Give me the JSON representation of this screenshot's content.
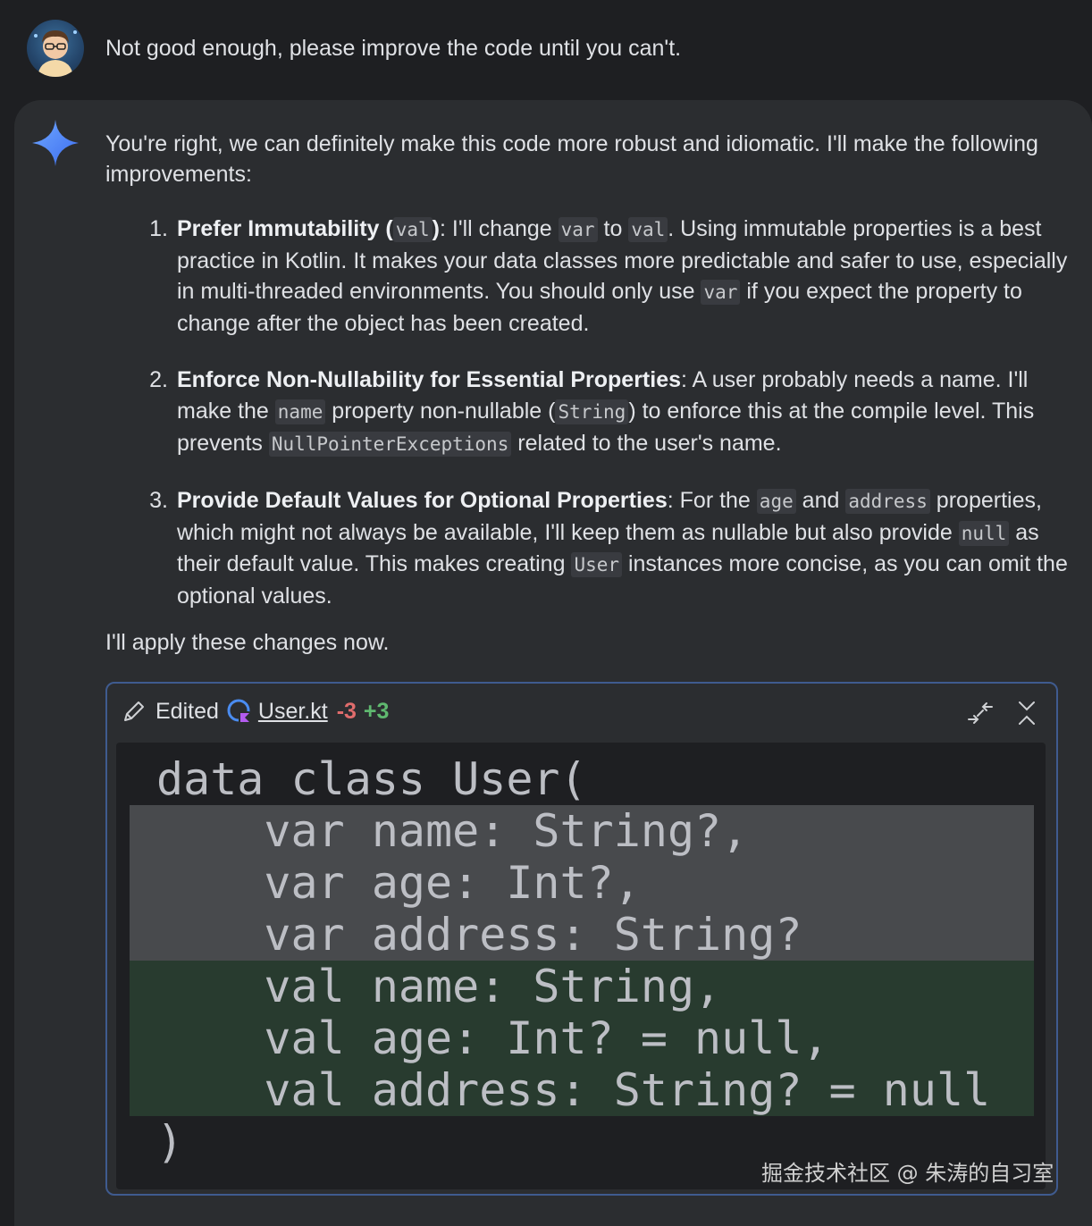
{
  "user_message": {
    "text": "Not good enough, please improve the code until you can't.",
    "avatar_icon": "user-avatar-icon"
  },
  "assistant": {
    "icon": "sparkle-icon",
    "intro": "You're right, we can definitely make this code more robust and idiomatic. I'll make the following improvements:",
    "items": [
      {
        "number": "1.",
        "title": "Prefer Immutability (",
        "title_code": "val",
        "title_end": ")",
        "parts": [
          {
            "t": ": I'll change "
          },
          {
            "c": "var"
          },
          {
            "t": " to "
          },
          {
            "c": "val"
          },
          {
            "t": ". Using immutable properties is a best practice in Kotlin. It makes your data classes more predictable and safer to use, especially in multi-threaded environments. You should only use "
          },
          {
            "c": "var"
          },
          {
            "t": " if you expect the property to change after the object has been created."
          }
        ]
      },
      {
        "number": "2.",
        "title": "Enforce Non-Nullability for Essential Properties",
        "title_code": "",
        "title_end": "",
        "parts": [
          {
            "t": ": A user probably needs a name. I'll make the "
          },
          {
            "c": "name"
          },
          {
            "t": " property non-nullable ("
          },
          {
            "c": "String"
          },
          {
            "t": ") to enforce this at the compile level. This prevents "
          },
          {
            "c": "NullPointerExceptions"
          },
          {
            "t": " related to the user's name."
          }
        ]
      },
      {
        "number": "3.",
        "title": "Provide Default Values for Optional Properties",
        "title_code": "",
        "title_end": "",
        "parts": [
          {
            "t": ": For the "
          },
          {
            "c": "age"
          },
          {
            "t": " and "
          },
          {
            "c": "address"
          },
          {
            "t": " properties, which might not always be available, I'll keep them as nullable but also provide "
          },
          {
            "c": "null"
          },
          {
            "t": " as their default value. This makes creating "
          },
          {
            "c": "User"
          },
          {
            "t": " instances more concise, as you can omit the optional values."
          }
        ]
      }
    ],
    "outro": "I'll apply these changes now."
  },
  "edit_card": {
    "action_label": "Edited",
    "file_name": "User.kt",
    "removed_count": "-3",
    "added_count": "+3",
    "pencil_icon": "pencil-icon",
    "file_icon": "kotlin-file-icon",
    "collapse_icon": "collapse-icon",
    "close_icon": "close-icon",
    "code_lines": [
      {
        "kind": "context",
        "text": "data class User("
      },
      {
        "kind": "removed",
        "text": "    var name: String?,"
      },
      {
        "kind": "removed",
        "text": "    var age: Int?,"
      },
      {
        "kind": "removed",
        "text": "    var address: String?"
      },
      {
        "kind": "added",
        "text": "    val name: String,"
      },
      {
        "kind": "added",
        "text": "    val age: Int? = null,"
      },
      {
        "kind": "added",
        "text": "    val address: String? = null"
      },
      {
        "kind": "context",
        "text": ")"
      }
    ]
  },
  "watermark": "掘金技术社区 @ 朱涛的自习室",
  "colors": {
    "background": "#1e1f22",
    "panel": "#2b2d30",
    "removed_line": "#484a4d",
    "added_line": "#283b2f",
    "minus": "#e06c6c",
    "plus": "#5fb86f",
    "card_border": "#3f5b8f"
  }
}
